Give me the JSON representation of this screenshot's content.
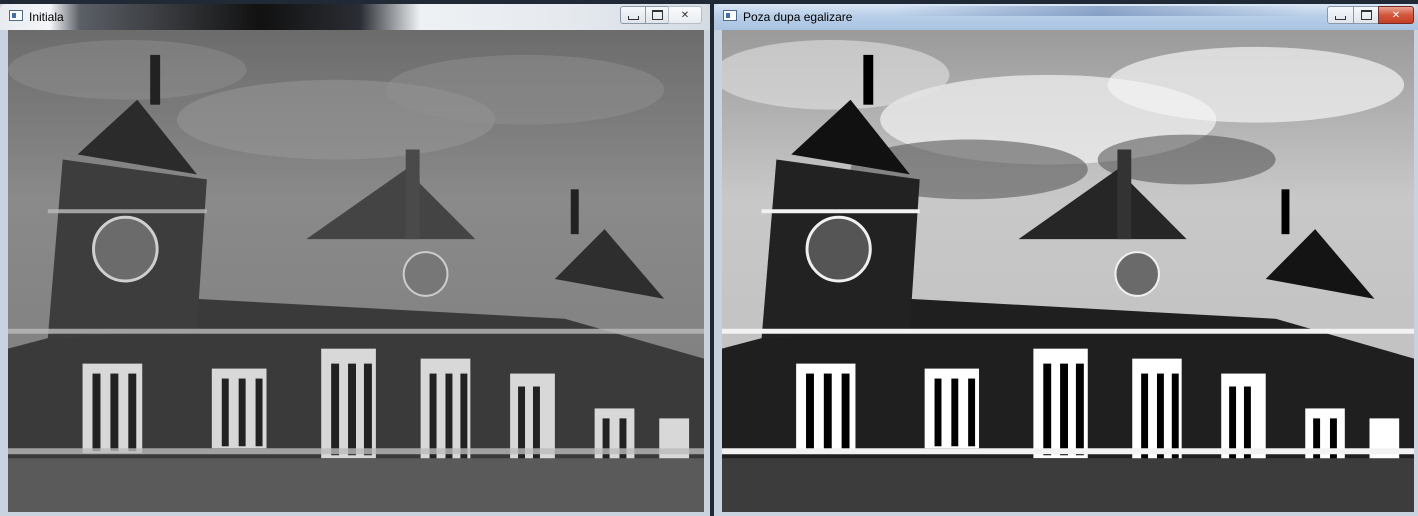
{
  "windows": [
    {
      "title": "Initiala",
      "icon": "window-app-icon",
      "controls": {
        "minimize": "minimize-icon",
        "maximize": "maximize-icon",
        "close": "✕"
      },
      "image": {
        "subject": "building-facade-photo",
        "tone": "original"
      }
    },
    {
      "title": "Poza dupa egalizare",
      "icon": "window-app-icon",
      "controls": {
        "minimize": "minimize-icon",
        "maximize": "maximize-icon",
        "close": "✕"
      },
      "image": {
        "subject": "building-facade-photo",
        "tone": "equalized"
      }
    }
  ],
  "colors": {
    "active_close": "#c43f25",
    "title_active": "#b9cfe8"
  }
}
